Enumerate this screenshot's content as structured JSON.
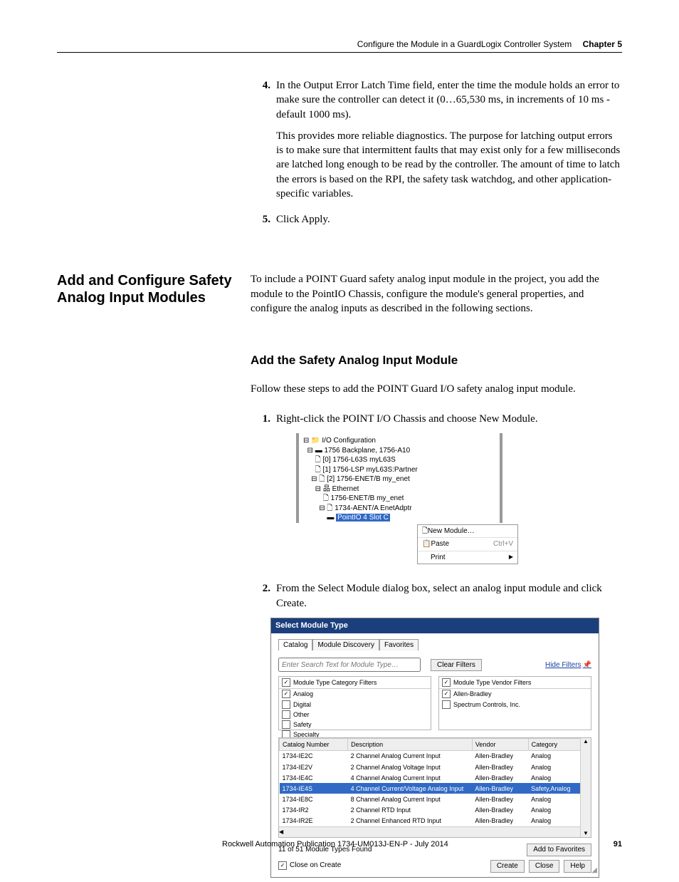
{
  "header": {
    "running": "Configure the Module in a GuardLogix Controller System",
    "chapter": "Chapter 5"
  },
  "steps_top": [
    {
      "num": "4.",
      "paras": [
        "In the Output Error Latch Time field, enter the time the module holds an error to make sure the controller can detect it (0…65,530 ms, in increments of 10 ms - default 1000 ms).",
        "This provides more reliable diagnostics. The purpose for latching output errors is to make sure that intermittent faults that may exist only for a few milliseconds are latched long enough to be read by the controller. The amount of time to latch the errors is based on the RPI, the safety task watchdog, and other application-specific variables."
      ]
    },
    {
      "num": "5.",
      "paras": [
        "Click Apply."
      ]
    }
  ],
  "section": {
    "sidehead": "Add and Configure Safety Analog Input Modules",
    "intro": "To include a POINT Guard safety analog input module in the project, you add the module to the PointIO Chassis, configure the module's general properties, and configure the analog inputs as described in the following sections.",
    "subhead": "Add the Safety Analog Input Module",
    "lead": "Follow these steps to add the POINT Guard I/O safety analog input module.",
    "step1": {
      "num": "1.",
      "text": "Right-click the POINT I/O Chassis and choose New Module."
    },
    "step2": {
      "num": "2.",
      "text": "From the Select Module dialog box, select an analog input module and click Create."
    }
  },
  "tree": {
    "root": "I/O Configuration",
    "n1": "1756 Backplane, 1756-A10",
    "n2": "[0] 1756-L63S myL63S",
    "n3": "[1] 1756-LSP myL63S:Partner",
    "n4": "[2] 1756-ENET/B my_enet",
    "n5": "Ethernet",
    "n6": "1756-ENET/B my_enet",
    "n7": "1734-AENT/A EnetAdptr",
    "n8": "PointIO 4 Slot C",
    "menu": {
      "new": "New Module…",
      "paste": "Paste",
      "paste_kbd": "Ctrl+V",
      "print": "Print"
    }
  },
  "dialog": {
    "title": "Select Module Type",
    "tabs": [
      "Catalog",
      "Module Discovery",
      "Favorites"
    ],
    "search_placeholder": "Enter Search Text for Module Type…",
    "clear": "Clear Filters",
    "hide": "Hide Filters",
    "cat_header": "Module Type Category Filters",
    "ven_header": "Module Type Vendor Filters",
    "cats": [
      "Analog",
      "Digital",
      "Other",
      "Safety",
      "Specialty"
    ],
    "cats_checked": [
      true,
      false,
      false,
      false,
      false
    ],
    "vendors": [
      "Allen-Bradley",
      "Spectrum Controls, Inc."
    ],
    "vendors_checked": [
      true,
      false
    ],
    "cols": [
      "Catalog Number",
      "Description",
      "Vendor",
      "Category"
    ],
    "rows": [
      {
        "c": "1734-IE2C",
        "d": "2 Channel Analog Current Input",
        "v": "Allen-Bradley",
        "g": "Analog",
        "sel": false
      },
      {
        "c": "1734-IE2V",
        "d": "2 Channel Analog Voltage Input",
        "v": "Allen-Bradley",
        "g": "Analog",
        "sel": false
      },
      {
        "c": "1734-IE4C",
        "d": "4 Channel Analog Current Input",
        "v": "Allen-Bradley",
        "g": "Analog",
        "sel": false
      },
      {
        "c": "1734-IE4S",
        "d": "4 Channel Current/Voltage Analog Input",
        "v": "Allen-Bradley",
        "g": "Safety,Analog",
        "sel": true
      },
      {
        "c": "1734-IE8C",
        "d": "8 Channel Analog Current Input",
        "v": "Allen-Bradley",
        "g": "Analog",
        "sel": false
      },
      {
        "c": "1734-IR2",
        "d": "2 Channel RTD Input",
        "v": "Allen-Bradley",
        "g": "Analog",
        "sel": false
      },
      {
        "c": "1734-IR2E",
        "d": "2 Channel Enhanced RTD Input",
        "v": "Allen-Bradley",
        "g": "Analog",
        "sel": false
      }
    ],
    "status": "11  of 51 Module Types Found",
    "addfav": "Add to Favorites",
    "close_on_create": "Close on Create",
    "create": "Create",
    "close": "Close",
    "help": "Help"
  },
  "footer": {
    "pub": "Rockwell Automation Publication 1734-UM013J-EN-P - July 2014",
    "page": "91"
  }
}
